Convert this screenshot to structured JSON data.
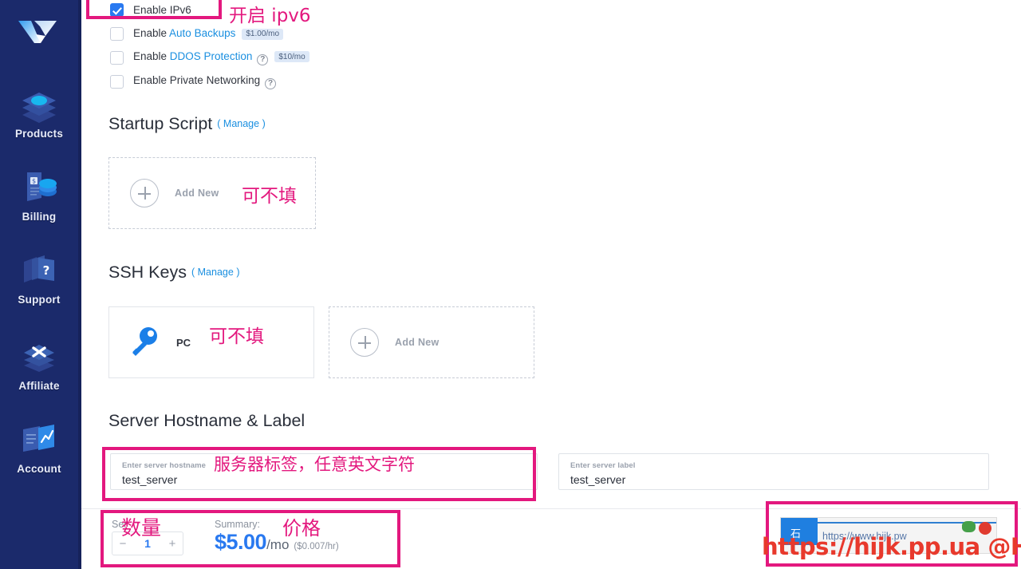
{
  "sidebar": {
    "brand": "vultr-logo",
    "items": [
      {
        "label": "Products",
        "icon": "layers-icon"
      },
      {
        "label": "Billing",
        "icon": "billing-coins-icon"
      },
      {
        "label": "Support",
        "icon": "support-question-icon"
      },
      {
        "label": "Affiliate",
        "icon": "affiliate-layers-x-icon"
      },
      {
        "label": "Account",
        "icon": "account-chart-icon"
      }
    ]
  },
  "options": {
    "ipv6": {
      "label_prefix": "Enable ",
      "link": "IPv6",
      "checked": true,
      "badge": "",
      "help": false
    },
    "backups": {
      "label_prefix": "Enable ",
      "link": "Auto Backups",
      "checked": false,
      "badge": "$1.00/mo",
      "help": false
    },
    "ddos": {
      "label_prefix": "Enable ",
      "link": "DDOS Protection",
      "checked": false,
      "badge": "$10/mo",
      "help": true
    },
    "private": {
      "label_prefix": "Enable ",
      "link": "Private Networking",
      "checked": false,
      "badge": "",
      "help": true,
      "plain": true
    }
  },
  "startup_script": {
    "title": "Startup Script",
    "manage_open": "(",
    "manage": "Manage",
    "manage_close": ")",
    "add_new": "Add New"
  },
  "ssh_keys": {
    "title": "SSH Keys",
    "manage_open": "(",
    "manage": "Manage",
    "manage_close": ")",
    "key_name": "PC",
    "add_new": "Add New"
  },
  "hostname_section": {
    "title": "Server Hostname & Label",
    "hostname_field": {
      "label": "Enter server hostname",
      "value": "test_server"
    },
    "label_field": {
      "label": "Enter server label",
      "value": "test_server"
    }
  },
  "bottom_bar": {
    "qty_label": "Ser",
    "summary_label": "Summary:",
    "qty_minus": "−",
    "qty_value": "1",
    "qty_plus": "+",
    "price_main": "$5.00",
    "price_period": "/mo",
    "price_hourly": "($0.007/hr)"
  },
  "annotations": {
    "ipv6": "开启 ipv6",
    "startup_optional": "可不填",
    "ssh_optional": "可不填",
    "hostname": "服务器标签，任意英文字符",
    "quantity": "数量",
    "price": "价格",
    "color": "#e3187e"
  },
  "watermark": {
    "widget_badge": "石",
    "widget_url": "https://www.hijk.pw",
    "overlay": "https://hijk.pp.ua @HIJK"
  }
}
